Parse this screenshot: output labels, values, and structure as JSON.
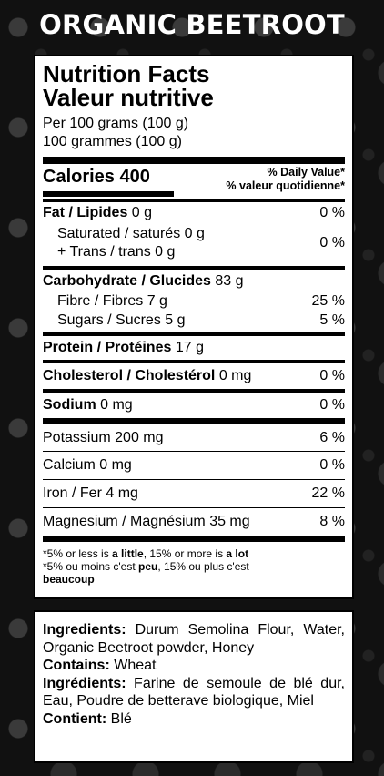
{
  "product_title": "ORGANIC BEETROOT",
  "nutrition": {
    "heading_en": "Nutrition Facts",
    "heading_fr": "Valeur nutritive",
    "serving_1": "Per 100 grams (100 g)",
    "serving_2": "100 grammes (100 g)",
    "calories_label": "Calories 400",
    "dv_1": "% Daily Value*",
    "dv_2": "% valeur quotidienne*",
    "fat": {
      "label": "Fat / Lipides",
      "amount": "0 g",
      "dv": "0 %"
    },
    "saturated": "Saturated / saturés 0 g",
    "trans": "+ Trans / trans 0 g",
    "sat_trans_dv": "0 %",
    "carb": {
      "label": "Carbohydrate / Glucides",
      "amount": "83 g"
    },
    "fibre": {
      "label": "Fibre / Fibres 7 g",
      "dv": "25 %"
    },
    "sugars": {
      "label": "Sugars / Sucres 5 g",
      "dv": "5 %"
    },
    "protein": {
      "label": "Protein / Protéines",
      "amount": "17 g"
    },
    "cholesterol": {
      "label": "Cholesterol / Cholestérol",
      "amount": "0 mg",
      "dv": "0 %"
    },
    "sodium": {
      "label": "Sodium",
      "amount": "0 mg",
      "dv": "0 %"
    },
    "potassium": {
      "label": "Potassium 200 mg",
      "dv": "6 %"
    },
    "calcium": {
      "label": "Calcium 0 mg",
      "dv": "0 %"
    },
    "iron": {
      "label": "Iron / Fer 4 mg",
      "dv": "22 %"
    },
    "magnesium": {
      "label": "Magnesium / Magnésium 35 mg",
      "dv": "8 %"
    },
    "foot_en_1": "*5% or less is ",
    "foot_en_2": "a little",
    "foot_en_3": ", 15% or more is ",
    "foot_en_4": "a lot",
    "foot_fr_1": "*5% ou moins c'est ",
    "foot_fr_2": "peu",
    "foot_fr_3": ", 15% ou plus c'est",
    "foot_fr_4": "beaucoup"
  },
  "ingredients": {
    "en_label": "Ingredients:",
    "en_text": " Durum Semolina Flour, Water, Organic Beetroot powder, Honey",
    "contains_label": "Contains:",
    "contains_text": " Wheat",
    "fr_label": "Ingrédients:",
    "fr_text": " Farine de semoule de blé dur, Eau, Poudre de betterave biologique, Miel",
    "contient_label": "Contient:",
    "contient_text": " Blé"
  }
}
